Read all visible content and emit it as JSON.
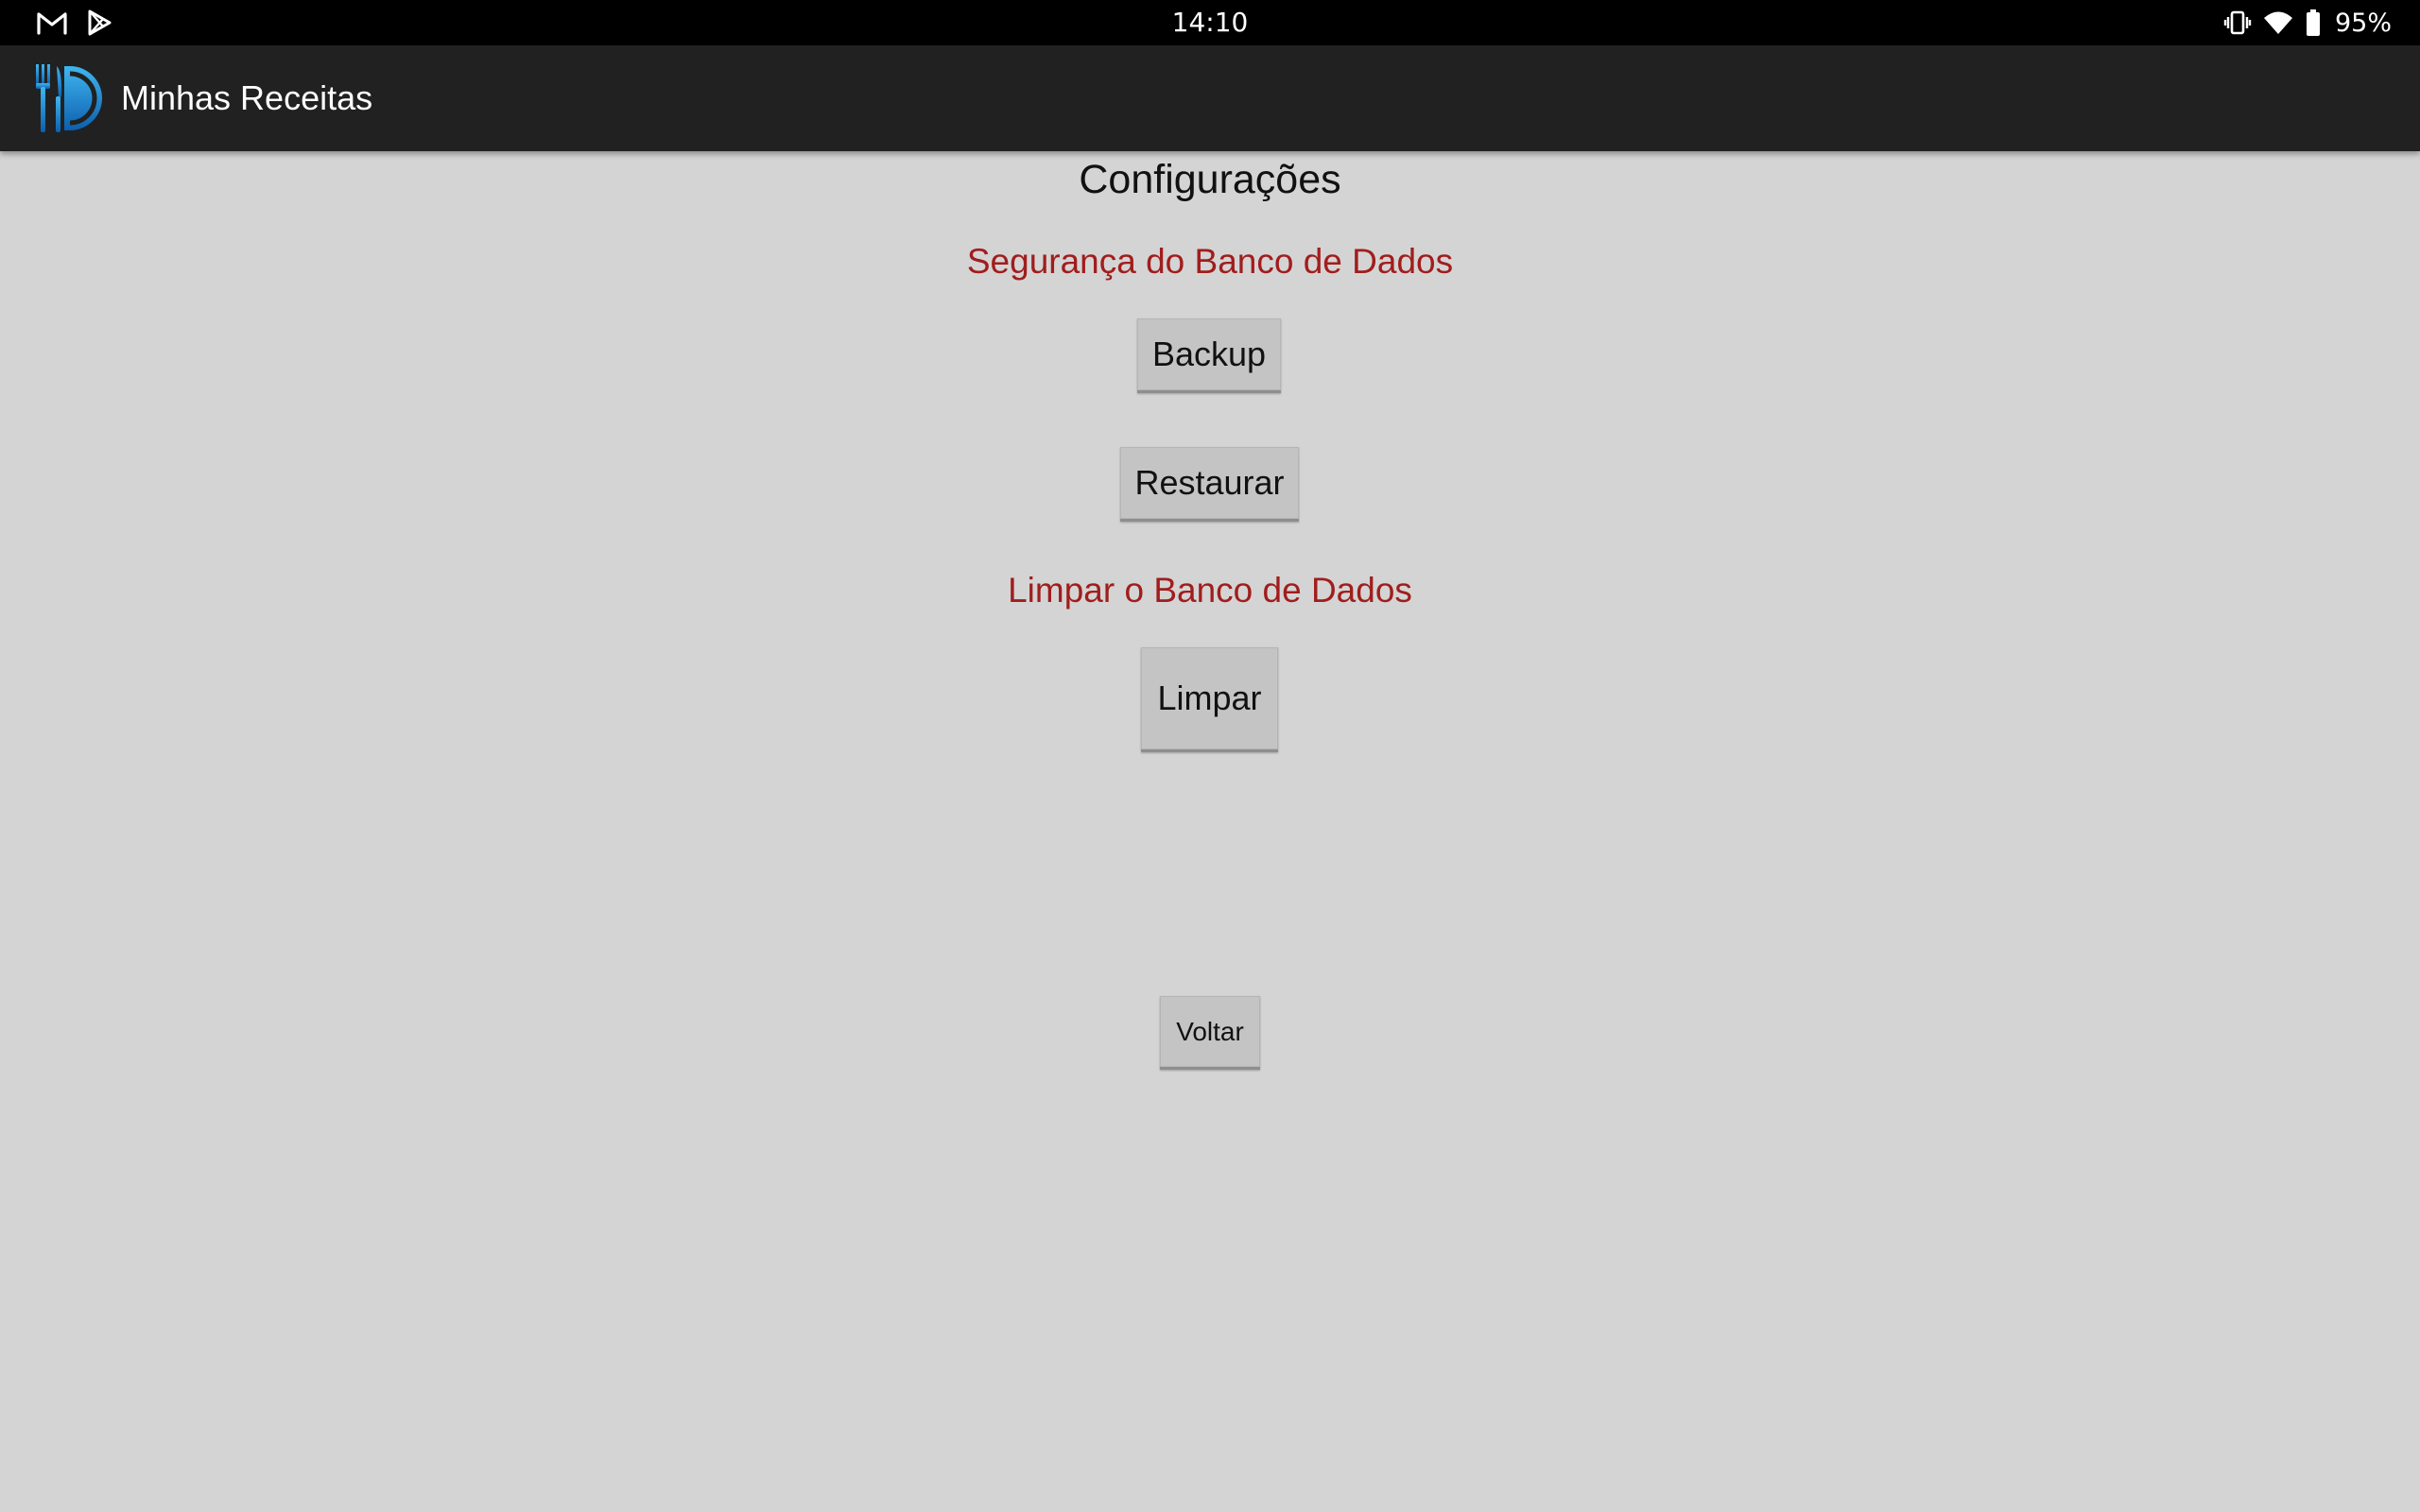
{
  "status_bar": {
    "time": "14:10",
    "battery_percent": "95%",
    "left_icons": [
      "gmail-icon",
      "play-store-icon"
    ],
    "right_icons": [
      "vibrate-icon",
      "wifi-icon",
      "battery-icon"
    ]
  },
  "app_bar": {
    "title": "Minhas Receitas",
    "logo": "restaurant-logo-icon"
  },
  "page": {
    "title": "Configurações",
    "backup_section": {
      "heading": "Segurança do Banco de Dados",
      "backup_label": "Backup",
      "restore_label": "Restaurar"
    },
    "clear_section": {
      "heading": "Limpar o Banco de Dados",
      "clear_label": "Limpar"
    },
    "back_label": "Voltar"
  },
  "colors": {
    "status_bar_bg": "#000000",
    "app_bar_bg": "#212121",
    "content_bg": "#d4d4d4",
    "section_heading": "#a11d1d",
    "button_bg": "#c4c4c4"
  }
}
